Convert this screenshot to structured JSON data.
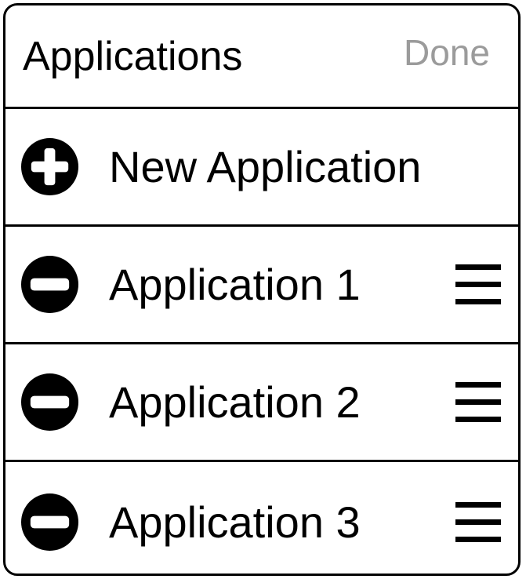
{
  "header": {
    "title": "Applications",
    "done_label": "Done"
  },
  "rows": [
    {
      "label": "New Application",
      "action_icon": "add-circle-icon"
    },
    {
      "label": "Application 1",
      "action_icon": "remove-circle-icon",
      "handle_icon": "drag-handle-icon"
    },
    {
      "label": "Application 2",
      "action_icon": "remove-circle-icon",
      "handle_icon": "drag-handle-icon"
    },
    {
      "label": "Application 3",
      "action_icon": "remove-circle-icon",
      "handle_icon": "drag-handle-icon"
    }
  ],
  "colors": {
    "border": "#000000",
    "text": "#000000",
    "done_disabled": "#9b9b9b",
    "background": "#ffffff"
  }
}
